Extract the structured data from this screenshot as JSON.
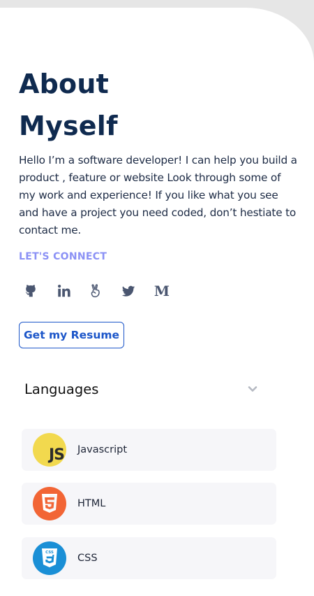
{
  "about": {
    "title_line1": "About",
    "title_line2": "Myself",
    "description": "Hello I’m a software developer! I can help you build a product , feature or website Look through some of my work and experience! If you like what you see and have a project you need coded, don’t hestiate to contact me.",
    "connect_label": "LET'S CONNECT"
  },
  "socials": [
    {
      "icon": "github-icon"
    },
    {
      "icon": "linkedin-icon"
    },
    {
      "icon": "angellist-icon"
    },
    {
      "icon": "twitter-icon"
    },
    {
      "icon": "medium-icon",
      "glyph": "M"
    }
  ],
  "resume": {
    "label": "Get my Resume"
  },
  "languages": {
    "header": "Languages",
    "items": [
      {
        "name": "Javascript",
        "logo_text": "JS",
        "color": "#f2d94e"
      },
      {
        "name": "HTML",
        "logo_text": "5",
        "color": "#f26535"
      },
      {
        "name": "CSS",
        "logo_text": "CSS",
        "color": "#1a8fd6"
      }
    ]
  },
  "colors": {
    "title": "#0f2a4f",
    "accent": "#8b91f5",
    "button": "#1c56c9",
    "icon": "#4a5670"
  }
}
